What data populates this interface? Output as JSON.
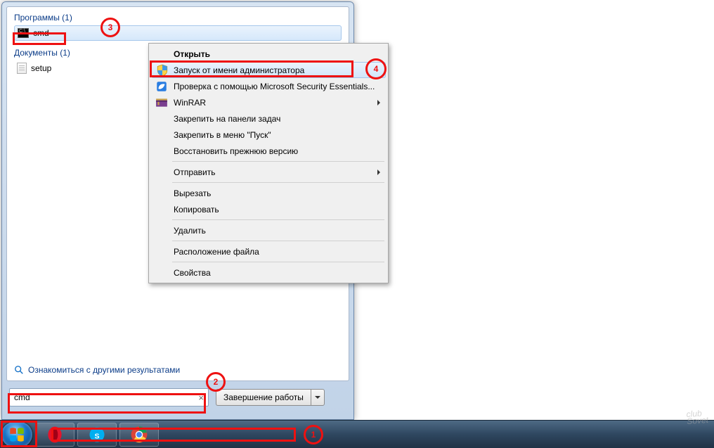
{
  "start_menu": {
    "programs_header": "Программы (1)",
    "program_item": "cmd",
    "documents_header": "Документы (1)",
    "document_item": "setup",
    "more_results": "Ознакомиться с другими результатами",
    "search_value": "cmd",
    "shutdown_label": "Завершение работы"
  },
  "context_menu": {
    "open": "Открыть",
    "run_as_admin": "Запуск от имени администратора",
    "mse_scan": "Проверка с помощью Microsoft Security Essentials...",
    "winrar": "WinRAR",
    "pin_taskbar": "Закрепить на панели задач",
    "pin_start": "Закрепить в меню \"Пуск\"",
    "restore_prev": "Восстановить прежнюю версию",
    "send_to": "Отправить",
    "cut": "Вырезать",
    "copy": "Копировать",
    "delete": "Удалить",
    "open_location": "Расположение файла",
    "properties": "Свойства"
  },
  "annotations": {
    "n1": "1",
    "n2": "2",
    "n3": "3",
    "n4": "4"
  },
  "watermark": {
    "top": "club",
    "bottom": "Sovet"
  }
}
